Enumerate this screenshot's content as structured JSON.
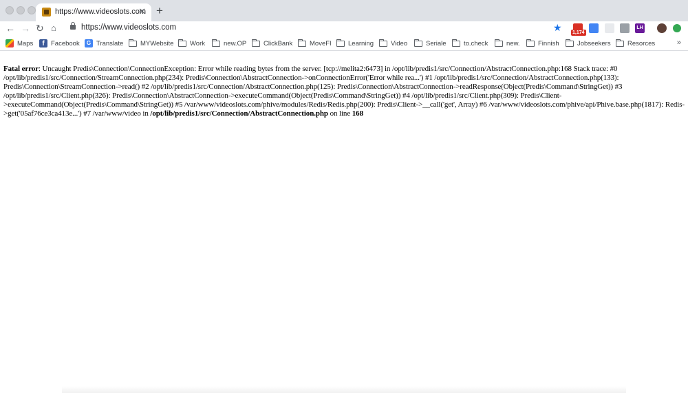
{
  "browser": {
    "tab": {
      "title": "https://www.videoslots.com"
    },
    "url": "https://www.videoslots.com",
    "extensions": [
      {
        "name": "adblock-icon",
        "badge": "1,174",
        "color": "#d93025"
      },
      {
        "name": "translate-icon",
        "color": "#4285f4"
      },
      {
        "name": "cloud-icon",
        "color": "#e8eaed"
      },
      {
        "name": "code-icon",
        "color": "#9aa0a6"
      },
      {
        "name": "lighthouse-icon",
        "label": "LH",
        "color": "#6a1b9a"
      },
      {
        "name": "profile-avatar",
        "color": "#5d4037"
      },
      {
        "name": "extension-green-icon",
        "color": "#34a853"
      }
    ]
  },
  "bookmarks": [
    {
      "label": "Maps",
      "icon": "maps-icon"
    },
    {
      "label": "Facebook",
      "icon": "facebook-icon"
    },
    {
      "label": "Translate",
      "icon": "translate-icon"
    },
    {
      "label": "MYWebsite",
      "icon": "folder-icon"
    },
    {
      "label": "Work",
      "icon": "folder-icon"
    },
    {
      "label": "new.OP",
      "icon": "folder-icon"
    },
    {
      "label": "ClickBank",
      "icon": "folder-icon"
    },
    {
      "label": "MoveFI",
      "icon": "folder-icon"
    },
    {
      "label": "Learning",
      "icon": "folder-icon"
    },
    {
      "label": "Video",
      "icon": "folder-icon"
    },
    {
      "label": "Seriale",
      "icon": "folder-icon"
    },
    {
      "label": "to.check",
      "icon": "folder-icon"
    },
    {
      "label": "new.",
      "icon": "folder-icon"
    },
    {
      "label": "Finnish",
      "icon": "folder-icon"
    },
    {
      "label": "Jobseekers",
      "icon": "folder-icon"
    },
    {
      "label": "Resorces",
      "icon": "folder-icon"
    }
  ],
  "error": {
    "label": "Fatal error",
    "message": ": Uncaught Predis\\Connection\\ConnectionException: Error while reading bytes from the server. [tcp://melita2:6473] in /opt/lib/predis1/src/Connection/AbstractConnection.php:168 Stack trace: #0 /opt/lib/predis1/src/Connection/StreamConnection.php(234): Predis\\Connection\\AbstractConnection->onConnectionError('Error while rea...') #1 /opt/lib/predis1/src/Connection/AbstractConnection.php(133): Predis\\Connection\\StreamConnection->read() #2 /opt/lib/predis1/src/Connection/AbstractConnection.php(125): Predis\\Connection\\AbstractConnection->readResponse(Object(Predis\\Command\\StringGet)) #3 /opt/lib/predis1/src/Client.php(326): Predis\\Connection\\AbstractConnection->executeCommand(Object(Predis\\Command\\StringGet)) #4 /opt/lib/predis1/src/Client.php(309): Predis\\Client->executeCommand(Object(Predis\\Command\\StringGet)) #5 /var/www/videoslots.com/phive/modules/Redis/Redis.php(200): Predis\\Client->__call('get', Array) #6 /var/www/videoslots.com/phive/api/Phive.base.php(1817): Redis->get('05af76ce3ca413e...') #7 /var/www/video in ",
    "file": "/opt/lib/predis1/src/Connection/AbstractConnection.php",
    "line_text": " on line ",
    "line": "168"
  }
}
